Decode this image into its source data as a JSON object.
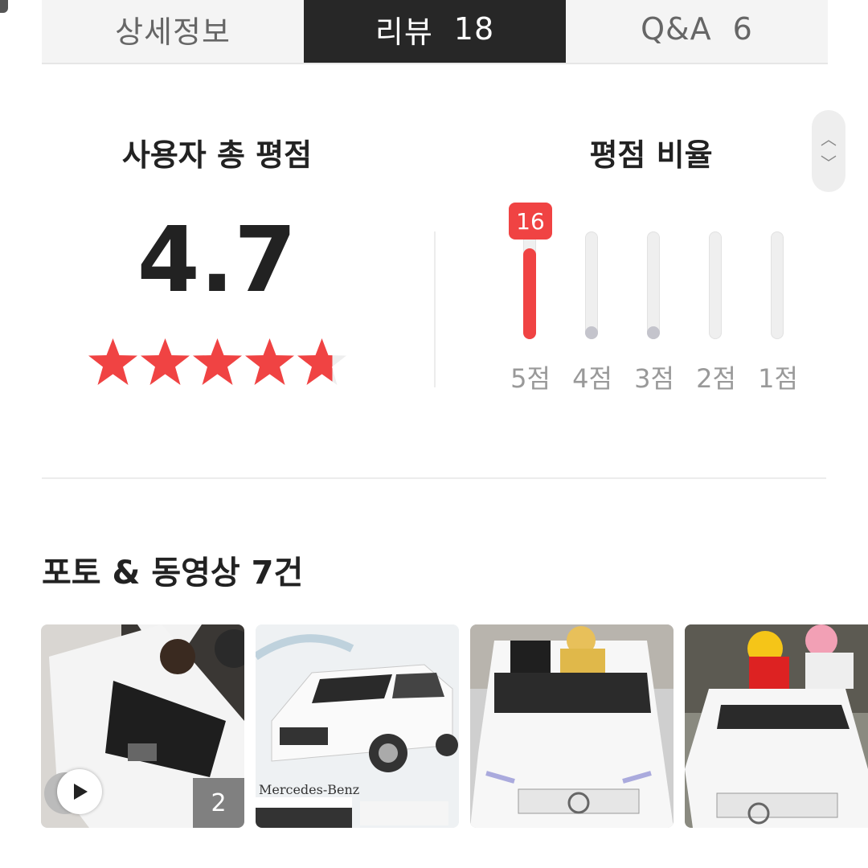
{
  "tabs": [
    {
      "label": "상세정보",
      "count": ""
    },
    {
      "label": "리뷰",
      "count": "18"
    },
    {
      "label": "Q&A",
      "count": "6"
    }
  ],
  "active_tab": 1,
  "summary": {
    "total_title": "사용자 총 평점",
    "score": "4.7",
    "star_rating": 4.7,
    "star_max": 5,
    "ratio_title": "평점 비율"
  },
  "rating_distribution": [
    {
      "label": "5점",
      "count": 16,
      "show_count": "16"
    },
    {
      "label": "4점",
      "count": 1
    },
    {
      "label": "3점",
      "count": 1
    },
    {
      "label": "2점",
      "count": 0
    },
    {
      "label": "1점",
      "count": 0
    }
  ],
  "colors": {
    "accent": "#f04343",
    "dark_tab": "#272727"
  },
  "photos": {
    "title": "포토 & 동영상 7건",
    "items": [
      {
        "type": "video",
        "badge": "2"
      },
      {
        "type": "photo",
        "caption": "Mercedes-Benz"
      },
      {
        "type": "photo"
      },
      {
        "type": "photo"
      }
    ]
  },
  "icons": {
    "scroll_up": "chevron-up-icon",
    "scroll_down": "chevron-down-icon",
    "play": "play-icon"
  }
}
